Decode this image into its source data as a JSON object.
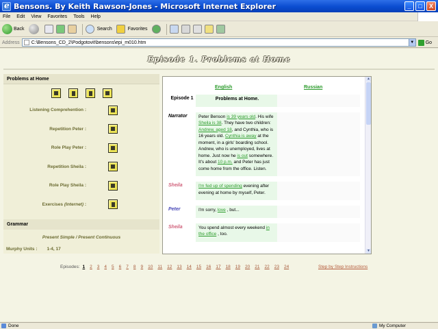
{
  "window": {
    "title": "Bensons. By Keith Rawson-Jones - Microsoft Internet Explorer",
    "minimize": "_",
    "maximize": "□",
    "close": "X"
  },
  "menu": [
    "File",
    "Edit",
    "View",
    "Favorites",
    "Tools",
    "Help"
  ],
  "toolbar": {
    "back": "Back",
    "search": "Search",
    "favorites": "Favorites"
  },
  "address": {
    "label": "Address",
    "url": "C:\\Bensons_CD_2\\Podgotovit\\bensons\\epi_m010.htm",
    "go": "Go"
  },
  "page": {
    "banner": "Episode 1. Problems at Home",
    "left": {
      "header": "Problems at Home",
      "activities": [
        {
          "label": "Listening Comprehention :"
        },
        {
          "label": "Repetition Peter :"
        },
        {
          "label": "Role Play Peter :"
        },
        {
          "label": "Repetition Sheila :"
        },
        {
          "label": "Role Play Sheila :"
        },
        {
          "label": "Exercises",
          "label_suffix": "(Internet)",
          "colon": ":"
        }
      ],
      "grammar_header": "Grammar",
      "grammar_topic": "Present Simple / Present Continuous",
      "murphy_label": "Murphy Units :",
      "murphy_value": "1-4, 17"
    },
    "dialog": {
      "english_tab": "English",
      "russian_tab": "Russian",
      "episode_label": "Episode 1",
      "episode_title": "Problems at Home.",
      "lines": [
        {
          "speaker": "Narrator",
          "speaker_color": "#000000",
          "segments": [
            {
              "t": "Peter Benson "
            },
            {
              "t": "is 39 years old",
              "link": true
            },
            {
              "t": ". His wife "
            },
            {
              "t": "Sheila is 38",
              "link": true
            },
            {
              "t": ". They have two children: "
            },
            {
              "t": "Andrew, aged 18",
              "link": true
            },
            {
              "t": ", and Cynthia, who is 16 years old. "
            },
            {
              "t": "Cynthia is away",
              "link": true
            },
            {
              "t": " at the moment, in a girls' boarding school. Andrew, who is unemployed, lives at home. Just now he "
            },
            {
              "t": "is out",
              "link": true
            },
            {
              "t": " somewhere. It's about "
            },
            {
              "t": "10 p.m.",
              "link": true
            },
            {
              "t": " and Peter has just come home from the office. Listen."
            }
          ]
        },
        {
          "speaker": "Sheila",
          "speaker_color": "#d0607a",
          "segments": [
            {
              "t": "I'm fed up of spending",
              "link": true
            },
            {
              "t": " evening after evening at home by myself, Peter."
            }
          ]
        },
        {
          "speaker": "Peter",
          "speaker_color": "#4a4ab8",
          "segments": [
            {
              "t": "I'm sorry, "
            },
            {
              "t": "love",
              "link": true
            },
            {
              "t": " , but..."
            }
          ]
        },
        {
          "speaker": "Sheila",
          "speaker_color": "#d0607a",
          "segments": [
            {
              "t": "You spend almost every weekend "
            },
            {
              "t": "in the office",
              "link": true
            },
            {
              "t": " , too."
            }
          ]
        }
      ]
    },
    "episodes": {
      "label": "Episodes:",
      "current": "1",
      "numbers": [
        "1",
        "2",
        "3",
        "4",
        "5",
        "6",
        "7",
        "8",
        "9",
        "10",
        "11",
        "12",
        "13",
        "14",
        "15",
        "16",
        "17",
        "18",
        "19",
        "20",
        "21",
        "22",
        "23",
        "24"
      ]
    },
    "instructions_link": "Step by Step Instructions"
  },
  "status": {
    "left": "Done",
    "right": "My Computer"
  },
  "colors": {
    "titlebar": "#0a4cd0",
    "link_green": "#2a9a2a",
    "episode_link": "#a65a3a",
    "olive_label": "#6a6a30",
    "button_yellow": "#ece458"
  }
}
